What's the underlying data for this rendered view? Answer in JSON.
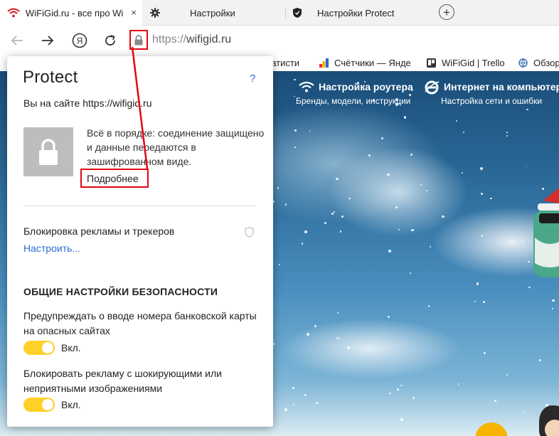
{
  "tabs": [
    {
      "label": "WiFiGid.ru - все про Wi",
      "icon": "wifi-icon",
      "active": true
    },
    {
      "label": "Настройки",
      "icon": "gear-icon",
      "active": false
    },
    {
      "label": "Настройки Protect",
      "icon": "shield-icon",
      "active": false
    }
  ],
  "tab_close": "×",
  "new_tab": "+",
  "toolbar": {
    "url_protocol": "https://",
    "url_host": "wifigid.ru"
  },
  "bookmarks": [
    {
      "label": "Статисти",
      "icon": "stats-icon"
    },
    {
      "label": "Счётчики — Янде",
      "icon": "metrica-icon"
    },
    {
      "label": "WiFiGid | Trello",
      "icon": "trello-icon"
    },
    {
      "label": "Обзор",
      "icon": "globe-icon"
    }
  ],
  "site_nav": [
    {
      "title": "Настройка роутера",
      "subtitle": "Бренды, модели, инструкции"
    },
    {
      "title": "Интернет на компьютере",
      "subtitle": "Настройка сети и ошибки"
    }
  ],
  "protect": {
    "title": "Protect",
    "help": "?",
    "site_line": "Вы на сайте https://wifigid.ru",
    "status": "Всё в порядке: соединение защищено и данные передаются в зашифрованном виде.",
    "details_link": "Подробнее",
    "ad_block_label": "Блокировка рекламы и трекеров",
    "configure_link": "Настроить...",
    "section_title": "ОБЩИЕ НАСТРОЙКИ БЕЗОПАСНОСТИ",
    "settings": [
      {
        "label": "Предупреждать о вводе номера банковской карты на опасных сайтах",
        "state": "Вкл.",
        "on": true
      },
      {
        "label": "Блокировать рекламу с шокирующими или неприятными изображениями",
        "state": "Вкл.",
        "on": true
      }
    ]
  },
  "colors": {
    "annotation": "#e30613",
    "toggle_on": "#ffd028",
    "link": "#2a6ed1"
  }
}
